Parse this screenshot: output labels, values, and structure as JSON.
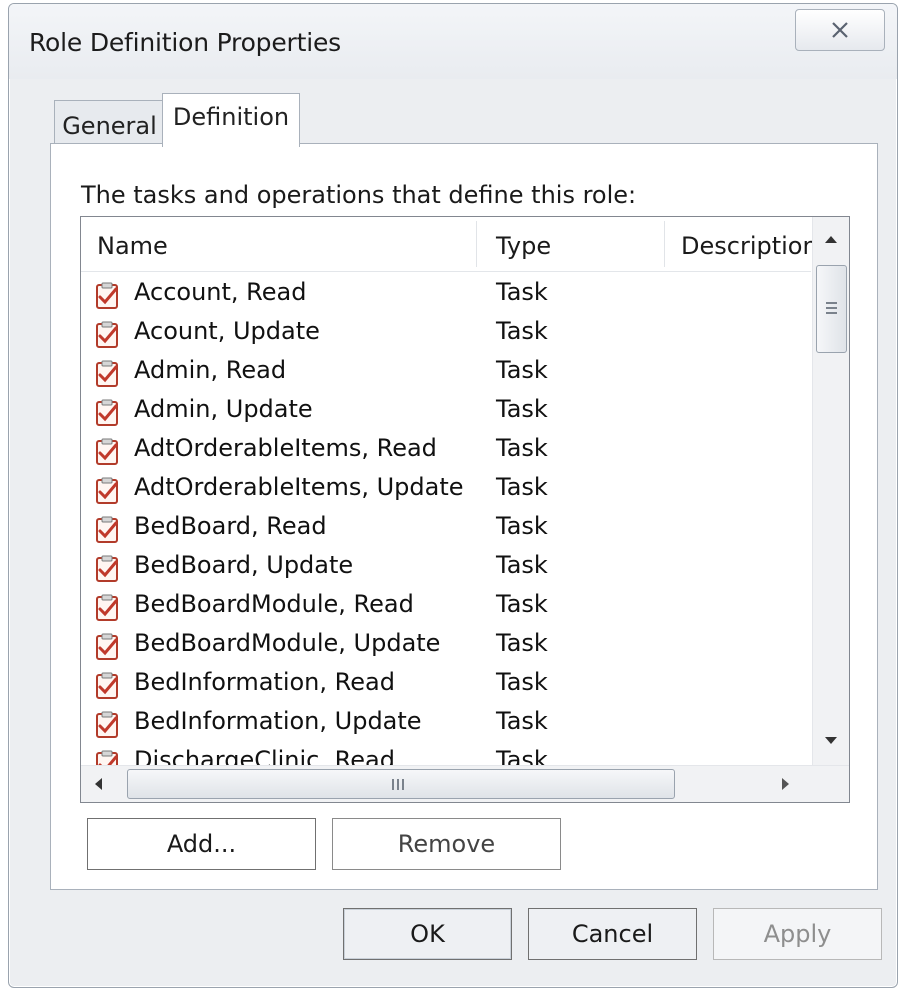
{
  "window": {
    "title": "Role Definition Properties"
  },
  "tabs": [
    {
      "label": "General",
      "selected": false
    },
    {
      "label": "Definition",
      "selected": true
    }
  ],
  "panel": {
    "caption": "The tasks and operations that define this role:"
  },
  "list": {
    "columns": [
      "Name",
      "Type",
      "Description"
    ],
    "rows": [
      {
        "name": "Account, Read",
        "type": "Task",
        "icon": "task-icon"
      },
      {
        "name": "Acount, Update",
        "type": "Task",
        "icon": "task-icon"
      },
      {
        "name": "Admin, Read",
        "type": "Task",
        "icon": "task-icon"
      },
      {
        "name": "Admin, Update",
        "type": "Task",
        "icon": "task-icon"
      },
      {
        "name": "AdtOrderableItems, Read",
        "type": "Task",
        "icon": "task-icon"
      },
      {
        "name": "AdtOrderableItems, Update",
        "type": "Task",
        "icon": "task-icon"
      },
      {
        "name": "BedBoard, Read",
        "type": "Task",
        "icon": "task-icon"
      },
      {
        "name": "BedBoard, Update",
        "type": "Task",
        "icon": "task-icon"
      },
      {
        "name": "BedBoardModule, Read",
        "type": "Task",
        "icon": "task-icon"
      },
      {
        "name": "BedBoardModule, Update",
        "type": "Task",
        "icon": "task-icon"
      },
      {
        "name": "BedInformation, Read",
        "type": "Task",
        "icon": "task-icon"
      },
      {
        "name": "BedInformation, Update",
        "type": "Task",
        "icon": "task-icon"
      },
      {
        "name": "DischargeClinic, Read",
        "type": "Task",
        "icon": "task-icon"
      }
    ]
  },
  "buttons": {
    "add": "Add...",
    "remove": "Remove",
    "ok": "OK",
    "cancel": "Cancel",
    "apply": "Apply"
  },
  "colors": {
    "window_bg": "#eceef1",
    "border": "#a9b1bb",
    "disabled_text": "#8e8e8e",
    "task_icon_red": "#c0392b"
  }
}
